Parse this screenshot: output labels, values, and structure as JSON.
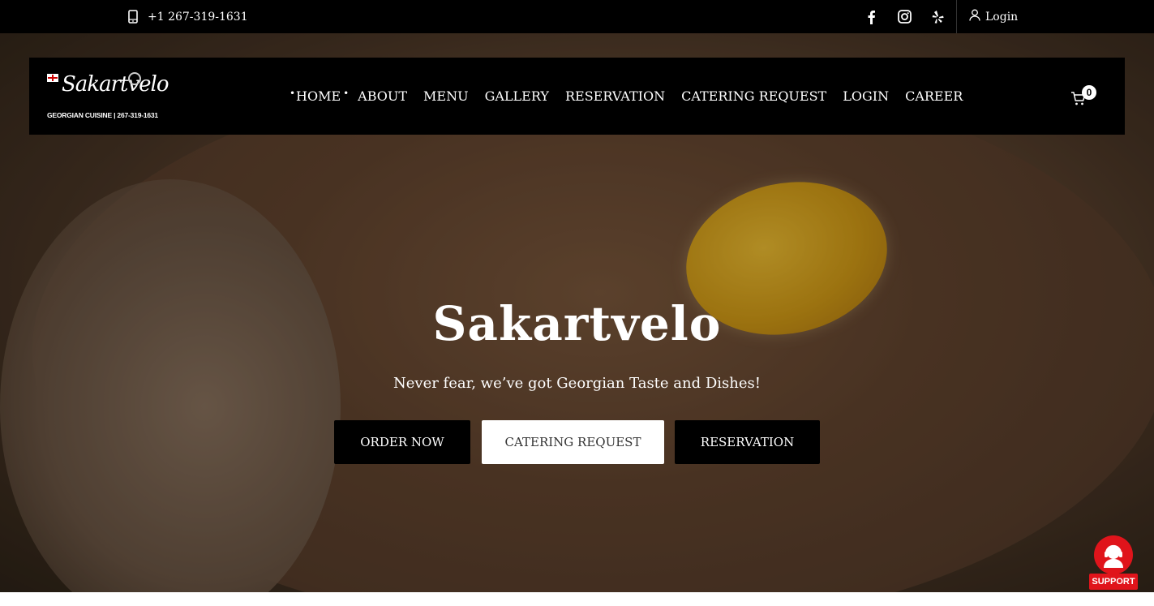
{
  "topbar": {
    "phone": "+1 267-319-1631",
    "social": [
      "facebook-icon",
      "instagram-icon",
      "yelp-icon"
    ],
    "login_label": "Login"
  },
  "logo": {
    "script": "Sakartvelo",
    "tagline": "GEORGIAN CUISINE | 267-319-1631"
  },
  "nav": {
    "items": [
      {
        "label": "HOME",
        "active": true
      },
      {
        "label": "ABOUT"
      },
      {
        "label": "MENU"
      },
      {
        "label": "GALLERY"
      },
      {
        "label": "RESERVATION"
      },
      {
        "label": "CATERING REQUEST"
      },
      {
        "label": "LOGIN"
      },
      {
        "label": "CAREER"
      }
    ],
    "cart_count": "0"
  },
  "hero": {
    "title": "Sakartvelo",
    "subtitle": "Never fear, we’ve got Georgian Taste and Dishes!",
    "buttons": {
      "order": "ORDER NOW",
      "catering": "CATERING REQUEST",
      "reservation": "RESERVATION"
    }
  },
  "support": {
    "label": "SUPPORT"
  },
  "colors": {
    "bar": "#000000",
    "support": "#e0141b"
  }
}
